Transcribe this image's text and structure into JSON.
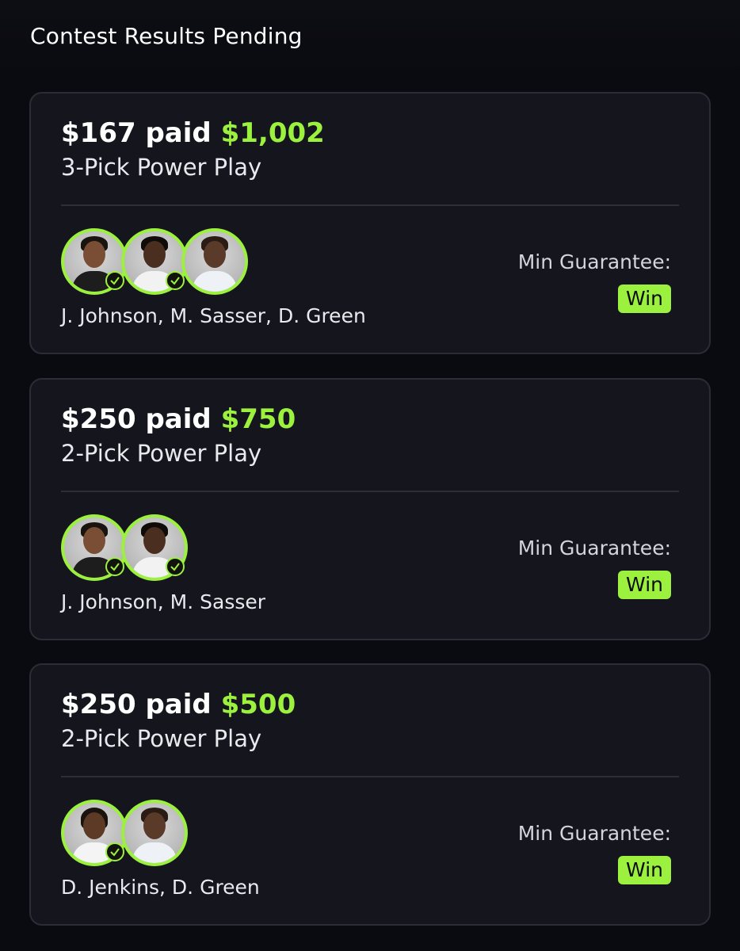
{
  "header": {
    "title": "Contest Results Pending"
  },
  "colors": {
    "accent": "#9cf03e",
    "card_bg": "#14151d",
    "page_bg": "#0a0b10"
  },
  "entries": [
    {
      "paid_text": "$167 paid",
      "payout": "$1,002",
      "contest_type": "3-Pick Power Play",
      "players_text": "J. Johnson, M. Sasser, D. Green",
      "guarantee_label": "Min Guarantee:",
      "guarantee_value": "Win",
      "picks": [
        {
          "player": "J. Johnson",
          "icon": "player-avatar",
          "checked": true
        },
        {
          "player": "M. Sasser",
          "icon": "player-avatar",
          "checked": true
        },
        {
          "player": "D. Green",
          "icon": "player-avatar",
          "checked": false
        }
      ]
    },
    {
      "paid_text": "$250 paid",
      "payout": "$750",
      "contest_type": "2-Pick Power Play",
      "players_text": "J. Johnson, M. Sasser",
      "guarantee_label": "Min Guarantee:",
      "guarantee_value": "Win",
      "picks": [
        {
          "player": "J. Johnson",
          "icon": "player-avatar",
          "checked": true
        },
        {
          "player": "M. Sasser",
          "icon": "player-avatar",
          "checked": true
        }
      ]
    },
    {
      "paid_text": "$250 paid",
      "payout": "$500",
      "contest_type": "2-Pick Power Play",
      "players_text": "D. Jenkins, D. Green",
      "guarantee_label": "Min Guarantee:",
      "guarantee_value": "Win",
      "picks": [
        {
          "player": "D. Jenkins",
          "icon": "player-avatar",
          "checked": true
        },
        {
          "player": "D. Green",
          "icon": "player-avatar",
          "checked": false
        }
      ]
    }
  ]
}
